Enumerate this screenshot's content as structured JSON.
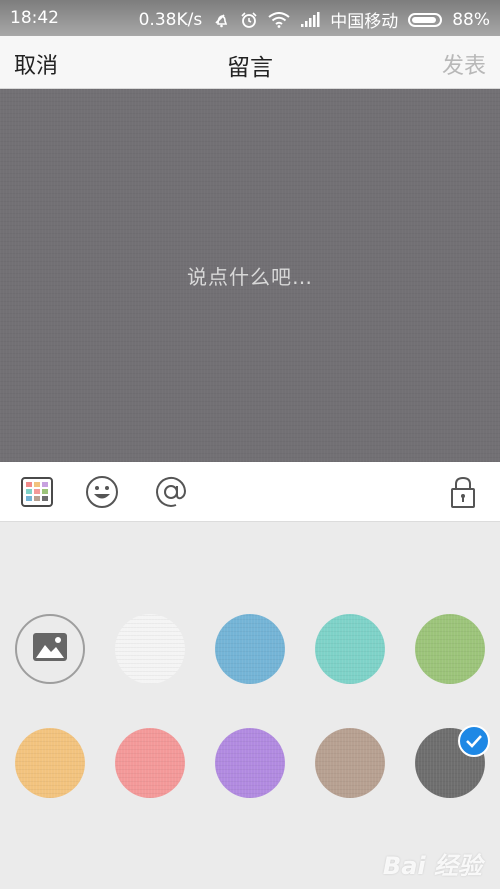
{
  "status_bar": {
    "time": "18:42",
    "speed": "0.38K/s",
    "carrier": "中国移动",
    "battery": "88%",
    "icons": [
      "mute-icon",
      "alarm-icon",
      "wifi-icon",
      "signal-icon",
      "battery-icon"
    ]
  },
  "nav": {
    "cancel_label": "取消",
    "title": "留言",
    "post_label": "发表"
  },
  "compose": {
    "placeholder": "说点什么吧…",
    "background_color": "#727074"
  },
  "toolbar": {
    "tools": [
      "template-grid-icon",
      "emoji-icon",
      "mention-icon",
      "lock-icon"
    ]
  },
  "backgrounds": {
    "items": [
      {
        "name": "photo",
        "color": null
      },
      {
        "name": "white",
        "color": "#f4f4f4"
      },
      {
        "name": "blue",
        "color": "#74b4d6"
      },
      {
        "name": "teal",
        "color": "#7ed2c8"
      },
      {
        "name": "green",
        "color": "#9cc47a"
      },
      {
        "name": "orange",
        "color": "#f2c37e"
      },
      {
        "name": "pink",
        "color": "#f39999"
      },
      {
        "name": "purple",
        "color": "#b18ae0"
      },
      {
        "name": "taupe",
        "color": "#b7a091"
      },
      {
        "name": "gray",
        "color": "#6e6e6e",
        "selected": true
      }
    ],
    "accent_color": "#1e88e5"
  },
  "watermark": {
    "text": "Bai 经验"
  }
}
